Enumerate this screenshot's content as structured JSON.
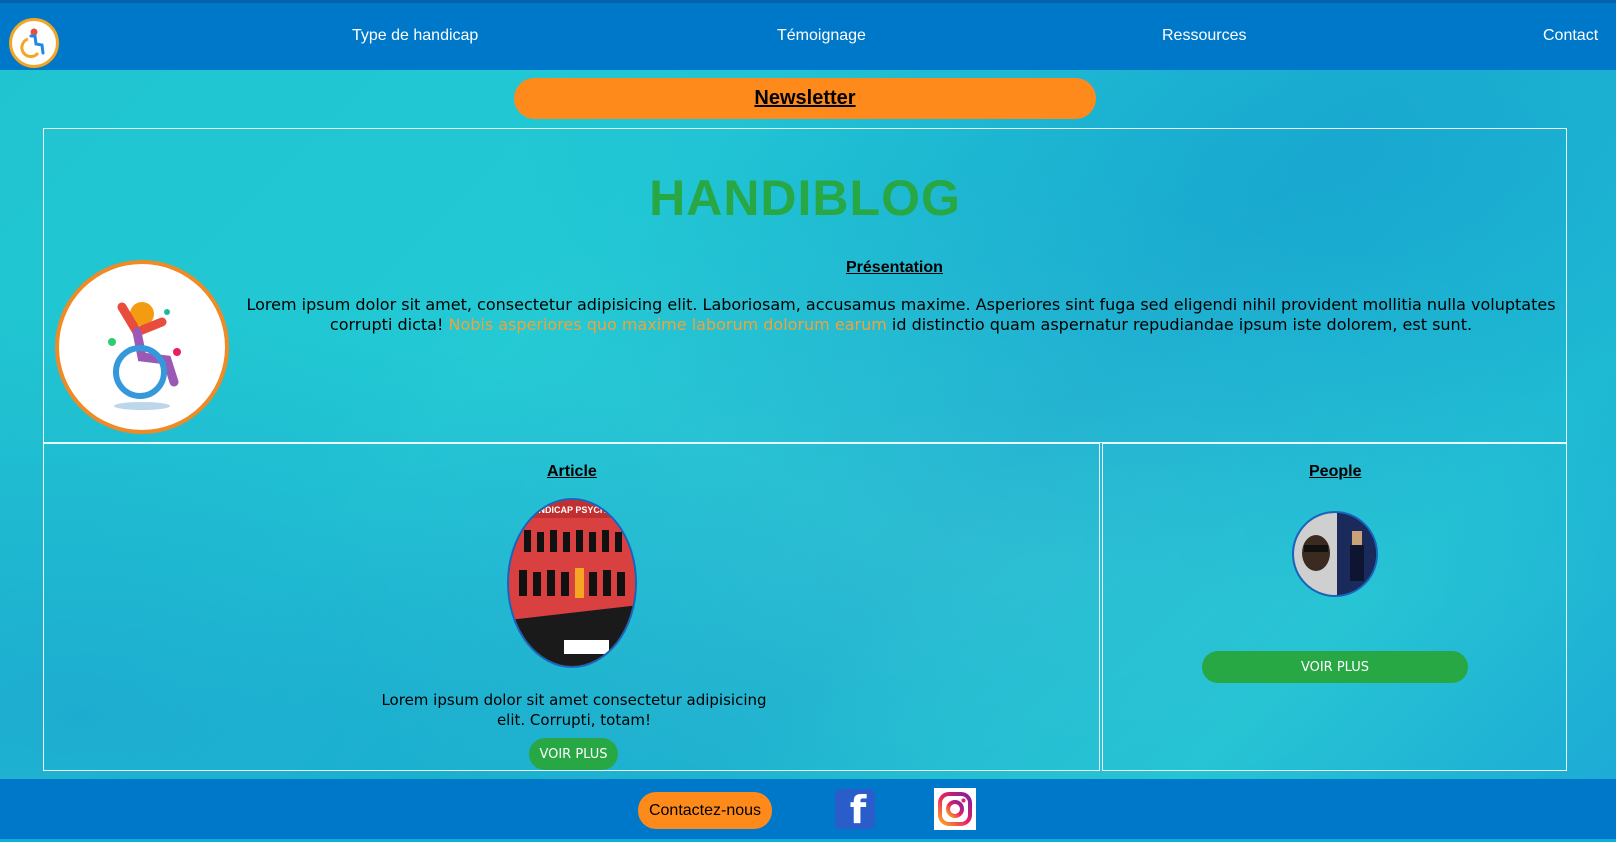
{
  "header": {
    "logo_icon": "wheelchair-logo",
    "nav": [
      {
        "label": "Type de handicap"
      },
      {
        "label": "Témoignage"
      },
      {
        "label": "Ressources"
      },
      {
        "label": "Contact"
      }
    ]
  },
  "newsletter": {
    "label": "Newsletter"
  },
  "hero": {
    "title": "HANDIBLOG",
    "image_icon": "colorful-wheelchair-icon",
    "presentation_heading": "Présentation",
    "presentation_text_1": "Lorem ipsum dolor sit amet, consectetur adipisicing elit. Laboriosam, accusamus maxime. Asperiores sint fuga sed eligendi nihil provident mollitia nulla voluptates corrupti dicta! ",
    "presentation_highlight": "Nobis asperiores quo maxime laborum dolorum earum",
    "presentation_text_2": " id distinctio quam aspernatur repudiandae ipsum iste dolorem, est sunt."
  },
  "article": {
    "heading": "Article",
    "image_caption": "HANDICAP PSYCHIQU",
    "text": "Lorem ipsum dolor sit amet consectetur adipisicing elit. Corrupti, totam!",
    "button": "VOIR PLUS"
  },
  "people": {
    "heading": "People",
    "image_icon": "people-photo",
    "button": "VOIR PLUS"
  },
  "footer": {
    "contact_button": "Contactez-nous",
    "facebook_icon": "facebook-icon",
    "instagram_icon": "instagram-icon"
  },
  "colors": {
    "header_bg": "#0078c9",
    "accent_orange": "#ff8a1c",
    "accent_green": "#27a844",
    "page_bg": "#1fc4d0"
  }
}
